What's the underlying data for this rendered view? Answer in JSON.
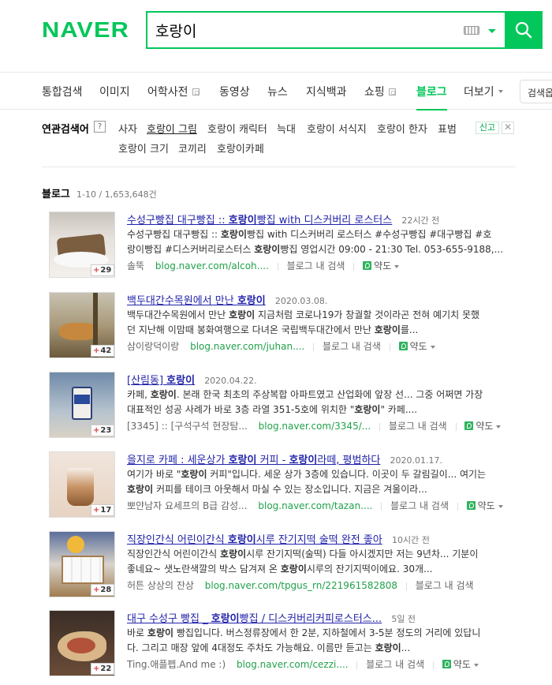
{
  "header": {
    "logo": "NAVER",
    "search_query": "호랑이"
  },
  "tabs": [
    {
      "label": "통합검색"
    },
    {
      "label": "이미지"
    },
    {
      "label": "어학사전"
    },
    {
      "label": "동영상"
    },
    {
      "label": "뉴스"
    },
    {
      "label": "지식백과"
    },
    {
      "label": "쇼핑"
    },
    {
      "label": "블로그"
    },
    {
      "label": "더보기"
    }
  ],
  "detail_search_label": "검색옵",
  "related": {
    "label": "연관검색어",
    "help": "?",
    "items": [
      "사자",
      "호랑이 그림",
      "호랑이 캐릭터",
      "늑대",
      "호랑이 서식지",
      "호랑이 한자",
      "표범",
      "호랑이 크기",
      "코끼리",
      "호랑이카페"
    ],
    "report": "신고",
    "close": "✕"
  },
  "section": {
    "title": "블로그",
    "count": "1-10 / 1,653,648건"
  },
  "results": [
    {
      "title": "수성구빵집 대구빵집 :: 호랑이빵집 with 디스커버리 로스터스",
      "date": "22시간 전",
      "desc1": "수성구빵집 대구빵집 :: 호랑이빵집 with 디스커버리 로스터스 #수성구빵집 #대구빵집 #호",
      "desc2": "랑이빵집 #디스커버리로스터스 호랑이빵집 영업시간 09:00 - 21:30 Tel. 053-655-9188,...",
      "author": "솔뚝",
      "url": "blog.naver.com/alcoh....",
      "inblog": "블로그 내 검색",
      "map": "약도",
      "count": "29"
    },
    {
      "title": "백두대간수목원에서 만난 호랑이",
      "date": "2020.03.08.",
      "desc1": "백두대간수목원에서 만난 호랑이 지금처럼 코로나19가 창궐할 것이라곤 전혀 예기치 못했",
      "desc2": "던 지난해 이맘때 봉화여행으로 다녀온 국립백두대간에서 만난 호랑이를...",
      "author": "삼이랑덕이랑",
      "url": "blog.naver.com/juhan....",
      "inblog": "블로그 내 검색",
      "map": "약도",
      "count": "42"
    },
    {
      "title": "[산림동] 호랑이",
      "date": "2020.04.22.",
      "desc1": "카페, 호랑이. 본래 한국 최초의 주상복합 아파트였고 산업화에 앞장 선... 그중 어쩌면 가장",
      "desc2": "대표적인 성공 사례가 바로 3층 라열 351-5호에 위치한 \"호랑이\" 카페....",
      "author": "[3345] :: [구석구석 현장탐...",
      "url": "blog.naver.com/3345/...",
      "inblog": "블로그 내 검색",
      "map": "약도",
      "count": "23"
    },
    {
      "title": "을지로 카페 : 세운상가 호랑이 커피 - 호랑이라떼, 평범하다",
      "date": "2020.01.17.",
      "desc1": "여기가 바로 \"호랑이 커피\"입니다. 세운 상가 3층에 있습니다. 이곳이 두 갈림길이... 여기는",
      "desc2": "호랑이 커피를 테이크 아웃해서 마실 수 있는 장소입니다. 지금은 겨울이라...",
      "author": "뽀얀남자 요세프의 B급 감성...",
      "url": "blog.naver.com/tazan....",
      "inblog": "블로그 내 검색",
      "map": "약도",
      "count": "17"
    },
    {
      "title": "직장인간식 어린이간식 호랑이시루 잔기지떡 술떡 완전 좋아",
      "date": "10시간 전",
      "desc1": "직장인간식 어린이간식 호랑이시루 잔기지떡(술떡) 다들 아시겠지만 저는 9년차... 기분이",
      "desc2": "좋네요~ 샛노란색깔의 박스 담겨져 온 호랑이시루의 잔기지떡이에요. 30개...",
      "author": "허튼 상상의 잔상",
      "url": "blog.naver.com/tpgus_rn/221961582808",
      "inblog": "블로그 내 검색",
      "map": "",
      "count": "28"
    },
    {
      "title": "대구 수성구 빵집 _ 호랑이빵집 / 디스커버리커피로스터스...",
      "date": "5일 전",
      "desc1": "바로 호랑이 빵집입니다. 버스정류장에서 한 2분, 지하철에서 3-5분 정도의 거리에 있답니",
      "desc2": "다. 그리고 매장 앞에 4대정도 주차도 가능해요. 이름만 듣고는 호랑이...",
      "author": "Ting.애플펩.And me :)",
      "url": "blog.naver.com/cezzi....",
      "inblog": "블로그 내 검색",
      "map": "약도",
      "count": "22"
    }
  ],
  "colors": {
    "brand": "#03c75a",
    "link": "#2122a9",
    "url": "#21a14b"
  }
}
